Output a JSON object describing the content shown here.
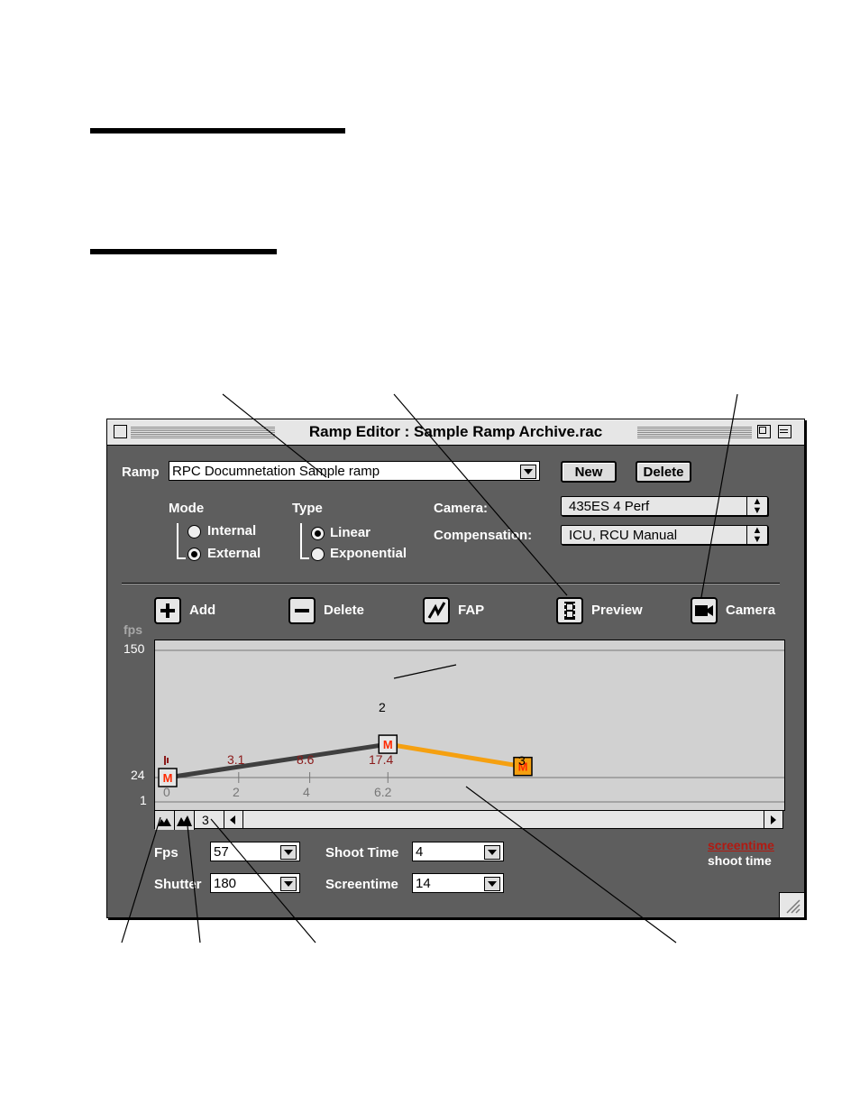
{
  "window": {
    "title": "Ramp Editor : Sample Ramp Archive.rac"
  },
  "ramp": {
    "label": "Ramp",
    "value": "RPC Documnetation Sample ramp",
    "new_label": "New",
    "delete_label": "Delete"
  },
  "mode": {
    "label": "Mode",
    "options": [
      "Internal",
      "External"
    ],
    "selected": "External"
  },
  "type": {
    "label": "Type",
    "options": [
      "Linear",
      "Exponential"
    ],
    "selected": "Linear"
  },
  "camera": {
    "label": "Camera:",
    "value": "435ES 4 Perf"
  },
  "compensation": {
    "label": "Compensation:",
    "value": "ICU, RCU Manual"
  },
  "toolbar": {
    "add_label": "Add",
    "delete_label": "Delete",
    "fap_label": "FAP",
    "preview_label": "Preview",
    "camera_label": "Camera"
  },
  "graph": {
    "axis_unit": "fps",
    "y_labels": [
      "150",
      "24",
      "1"
    ],
    "time_labels_top": [
      "3.1",
      "8.6",
      "17.4"
    ],
    "time_labels_bottom": [
      "0",
      "2",
      "4",
      "6.2"
    ],
    "marker_glyph": "M",
    "point_labels": [
      "2",
      "3"
    ],
    "points": [
      {
        "t": 0,
        "fps": 24
      },
      {
        "t": 6.2,
        "fps": 57
      },
      {
        "t": 10,
        "fps": 35
      }
    ],
    "colors": {
      "line_dark": "#3f3f3f",
      "line_active": "#f5a010",
      "marker": "#ff2a00",
      "time_top": "#8b1a1a"
    }
  },
  "scroll": {
    "count": "3"
  },
  "fields": {
    "fps_label": "Fps",
    "fps_value": "57",
    "shutter_label": "Shutter",
    "shutter_value": "180",
    "shoot_time_label": "Shoot Time",
    "shoot_time_value": "4",
    "screentime_label": "Screentime",
    "screentime_value": "14"
  },
  "legend": {
    "screentime": "screentime",
    "shoot_time": "shoot time",
    "screentime_color": "#b01a12"
  }
}
